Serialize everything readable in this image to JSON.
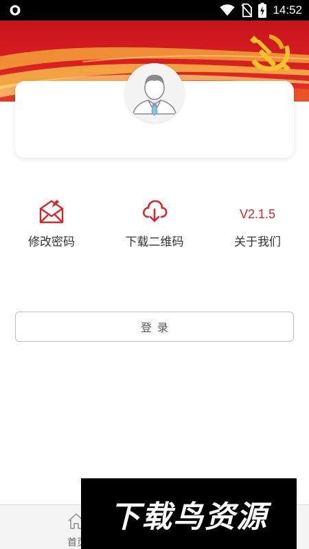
{
  "status_bar": {
    "time": "14:52"
  },
  "profile": {
    "avatar_icon": "user-avatar-icon"
  },
  "menu": {
    "items": [
      {
        "label": "修改密码",
        "icon": "envelope-pen-icon"
      },
      {
        "label": "下载二维码",
        "icon": "cloud-download-icon"
      },
      {
        "label": "关于我们",
        "version": "V2.1.5"
      }
    ]
  },
  "login": {
    "label": "登录"
  },
  "bottom_nav": {
    "home_label": "首页",
    "home_icon": "home-icon"
  },
  "watermark": {
    "text": "下载鸟资源"
  },
  "colors": {
    "accent_red": "#d8262b",
    "banner_red": "#d91f22",
    "emblem_gold": "#f5c22b"
  }
}
